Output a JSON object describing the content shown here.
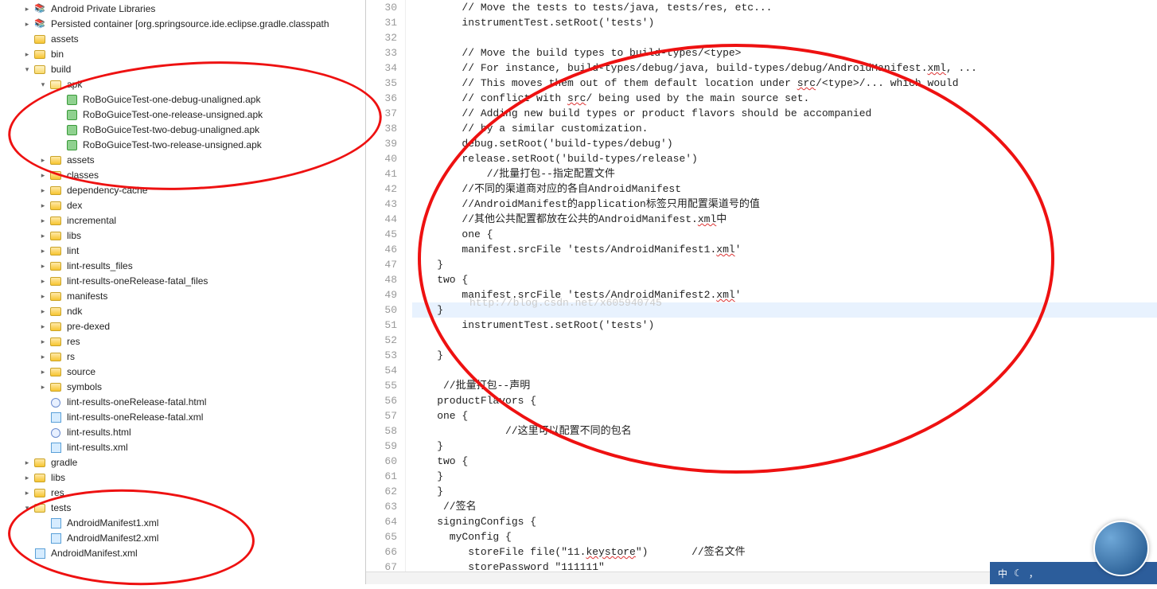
{
  "tree": [
    {
      "depth": 1,
      "twisty": "closed",
      "icon": "lib",
      "label": "Android Private Libraries",
      "interact": true
    },
    {
      "depth": 1,
      "twisty": "closed",
      "icon": "lib",
      "label": "Persisted container [org.springsource.ide.eclipse.gradle.classpath",
      "interact": true
    },
    {
      "depth": 1,
      "twisty": "none",
      "icon": "folder",
      "label": "assets",
      "interact": true
    },
    {
      "depth": 1,
      "twisty": "closed",
      "icon": "folder",
      "label": "bin",
      "interact": true
    },
    {
      "depth": 1,
      "twisty": "open",
      "icon": "folder-open",
      "label": "build",
      "interact": true
    },
    {
      "depth": 2,
      "twisty": "open",
      "icon": "folder-open",
      "label": "apk",
      "interact": true
    },
    {
      "depth": 3,
      "twisty": "none",
      "icon": "apk",
      "label": "RoBoGuiceTest-one-debug-unaligned.apk",
      "interact": true
    },
    {
      "depth": 3,
      "twisty": "none",
      "icon": "apk",
      "label": "RoBoGuiceTest-one-release-unsigned.apk",
      "interact": true
    },
    {
      "depth": 3,
      "twisty": "none",
      "icon": "apk",
      "label": "RoBoGuiceTest-two-debug-unaligned.apk",
      "interact": true
    },
    {
      "depth": 3,
      "twisty": "none",
      "icon": "apk",
      "label": "RoBoGuiceTest-two-release-unsigned.apk",
      "interact": true
    },
    {
      "depth": 2,
      "twisty": "closed",
      "icon": "folder",
      "label": "assets",
      "interact": true
    },
    {
      "depth": 2,
      "twisty": "closed",
      "icon": "folder",
      "label": "classes",
      "interact": true
    },
    {
      "depth": 2,
      "twisty": "closed",
      "icon": "folder",
      "label": "dependency-cache",
      "interact": true
    },
    {
      "depth": 2,
      "twisty": "closed",
      "icon": "folder",
      "label": "dex",
      "interact": true
    },
    {
      "depth": 2,
      "twisty": "closed",
      "icon": "folder",
      "label": "incremental",
      "interact": true
    },
    {
      "depth": 2,
      "twisty": "closed",
      "icon": "folder",
      "label": "libs",
      "interact": true
    },
    {
      "depth": 2,
      "twisty": "closed",
      "icon": "folder",
      "label": "lint",
      "interact": true
    },
    {
      "depth": 2,
      "twisty": "closed",
      "icon": "folder",
      "label": "lint-results_files",
      "interact": true
    },
    {
      "depth": 2,
      "twisty": "closed",
      "icon": "folder",
      "label": "lint-results-oneRelease-fatal_files",
      "interact": true
    },
    {
      "depth": 2,
      "twisty": "closed",
      "icon": "folder",
      "label": "manifests",
      "interact": true
    },
    {
      "depth": 2,
      "twisty": "closed",
      "icon": "folder",
      "label": "ndk",
      "interact": true
    },
    {
      "depth": 2,
      "twisty": "closed",
      "icon": "folder",
      "label": "pre-dexed",
      "interact": true
    },
    {
      "depth": 2,
      "twisty": "closed",
      "icon": "folder",
      "label": "res",
      "interact": true
    },
    {
      "depth": 2,
      "twisty": "closed",
      "icon": "folder",
      "label": "rs",
      "interact": true
    },
    {
      "depth": 2,
      "twisty": "closed",
      "icon": "folder",
      "label": "source",
      "interact": true
    },
    {
      "depth": 2,
      "twisty": "closed",
      "icon": "folder",
      "label": "symbols",
      "interact": true
    },
    {
      "depth": 2,
      "twisty": "none",
      "icon": "html",
      "label": "lint-results-oneRelease-fatal.html",
      "interact": true
    },
    {
      "depth": 2,
      "twisty": "none",
      "icon": "xml",
      "label": "lint-results-oneRelease-fatal.xml",
      "interact": true
    },
    {
      "depth": 2,
      "twisty": "none",
      "icon": "html",
      "label": "lint-results.html",
      "interact": true
    },
    {
      "depth": 2,
      "twisty": "none",
      "icon": "xml",
      "label": "lint-results.xml",
      "interact": true
    },
    {
      "depth": 1,
      "twisty": "closed",
      "icon": "folder",
      "label": "gradle",
      "interact": true
    },
    {
      "depth": 1,
      "twisty": "closed",
      "icon": "folder",
      "label": "libs",
      "interact": true
    },
    {
      "depth": 1,
      "twisty": "closed",
      "icon": "folder",
      "label": "res",
      "interact": true
    },
    {
      "depth": 1,
      "twisty": "open",
      "icon": "folder-open",
      "label": "tests",
      "interact": true
    },
    {
      "depth": 2,
      "twisty": "none",
      "icon": "xml",
      "label": "AndroidManifest1.xml",
      "interact": true
    },
    {
      "depth": 2,
      "twisty": "none",
      "icon": "xml",
      "label": "AndroidManifest2.xml",
      "interact": true
    },
    {
      "depth": 1,
      "twisty": "none",
      "icon": "xml",
      "label": "AndroidManifest.xml",
      "interact": true
    }
  ],
  "code": {
    "start": 30,
    "highlight": 50,
    "lines": [
      "        // Move the tests to tests/java, tests/res, etc...",
      "        instrumentTest.setRoot('tests')",
      "",
      "        // Move the build types to build-types/<type>",
      "        // For instance, build-types/debug/java, build-types/debug/AndroidManifest.xml, ...",
      "        // This moves them out of them default location under src/<type>/... which would",
      "        // conflict with src/ being used by the main source set.",
      "        // Adding new build types or product flavors should be accompanied",
      "        // by a similar customization.",
      "        debug.setRoot('build-types/debug')",
      "        release.setRoot('build-types/release')",
      "            //批量打包--指定配置文件",
      "        //不同的渠道商对应的各自AndroidManifest",
      "        //AndroidManifest的application标签只用配置渠道号的值",
      "        //其他公共配置都放在公共的AndroidManifest.xml中",
      "        one {",
      "        manifest.srcFile 'tests/AndroidManifest1.xml'",
      "    }",
      "    two {",
      "        manifest.srcFile 'tests/AndroidManifest2.xml'",
      "    }",
      "        instrumentTest.setRoot('tests')",
      "",
      "    }",
      "",
      "     //批量打包--声明",
      "    productFlavors {",
      "    one {",
      "               //这里可以配置不同的包名",
      "    }",
      "    two {",
      "    }",
      "    }",
      "     //签名",
      "    signingConfigs {",
      "      myConfig {",
      "         storeFile file(\"11.keystore\")       //签名文件",
      "         storePassword \"111111\""
    ]
  },
  "watermark": "http://blog.csdn.net/x605940745",
  "taskbar": {
    "ime": "中",
    "moon": "☾",
    "comma": "，"
  }
}
